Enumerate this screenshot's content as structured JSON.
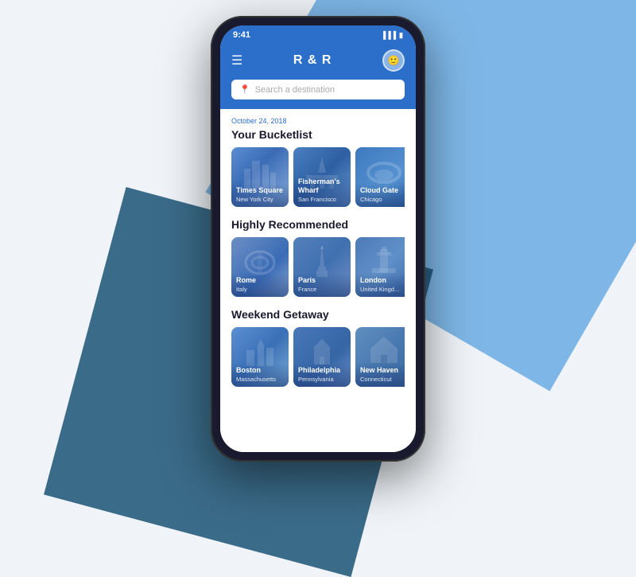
{
  "background": {
    "shape1_color": "#4d9de0",
    "shape2_color": "#1a5276"
  },
  "status_bar": {
    "time": "9:41",
    "signal": "▐▐▐",
    "battery": "▮▮▮"
  },
  "header": {
    "menu_icon": "☰",
    "title": "R & R",
    "avatar_initials": "👤"
  },
  "search": {
    "placeholder": "Search a destination",
    "icon": "📍"
  },
  "date_label": "October 24, 2018",
  "sections": [
    {
      "id": "bucketlist",
      "title": "Your Bucketlist",
      "cards": [
        {
          "name": "Times Square",
          "subname": "New York City",
          "css_class": "card-times-square"
        },
        {
          "name": "Fisherman's Wharf",
          "subname": "San Francisco",
          "css_class": "card-fishermans-wharf"
        },
        {
          "name": "Cloud Gate",
          "subname": "Chicago",
          "css_class": "card-cloud-gate"
        }
      ]
    },
    {
      "id": "highly-recommended",
      "title": "Highly Recommended",
      "cards": [
        {
          "name": "Rome",
          "subname": "Italy",
          "css_class": "card-rome"
        },
        {
          "name": "Paris",
          "subname": "France",
          "css_class": "card-paris"
        },
        {
          "name": "London",
          "subname": "United Kingdom",
          "css_class": "card-london"
        }
      ]
    },
    {
      "id": "weekend-getaway",
      "title": "Weekend Getaway",
      "cards": [
        {
          "name": "Boston",
          "subname": "Massachusetts",
          "css_class": "card-boston"
        },
        {
          "name": "Philadelphia",
          "subname": "Pennsylvania",
          "css_class": "card-philadelphia"
        },
        {
          "name": "New Haven",
          "subname": "Connecticut",
          "css_class": "card-new-haven"
        }
      ]
    }
  ]
}
